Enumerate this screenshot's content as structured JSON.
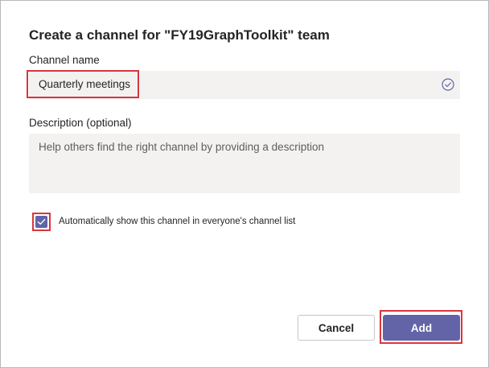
{
  "dialog": {
    "title": "Create a channel for \"FY19GraphToolkit\" team",
    "channel_name": {
      "label": "Channel name",
      "value": "Quarterly meetings",
      "valid_icon": "check-circle-icon"
    },
    "description": {
      "label": "Description (optional)",
      "placeholder": "Help others find the right channel by providing a description",
      "value": ""
    },
    "auto_show": {
      "label": "Automatically show this channel in everyone's channel list",
      "checked": true
    },
    "buttons": {
      "cancel": "Cancel",
      "add": "Add"
    }
  },
  "colors": {
    "accent": "#6264a7",
    "highlight": "#d9363e",
    "field_background": "#f3f2f1"
  }
}
